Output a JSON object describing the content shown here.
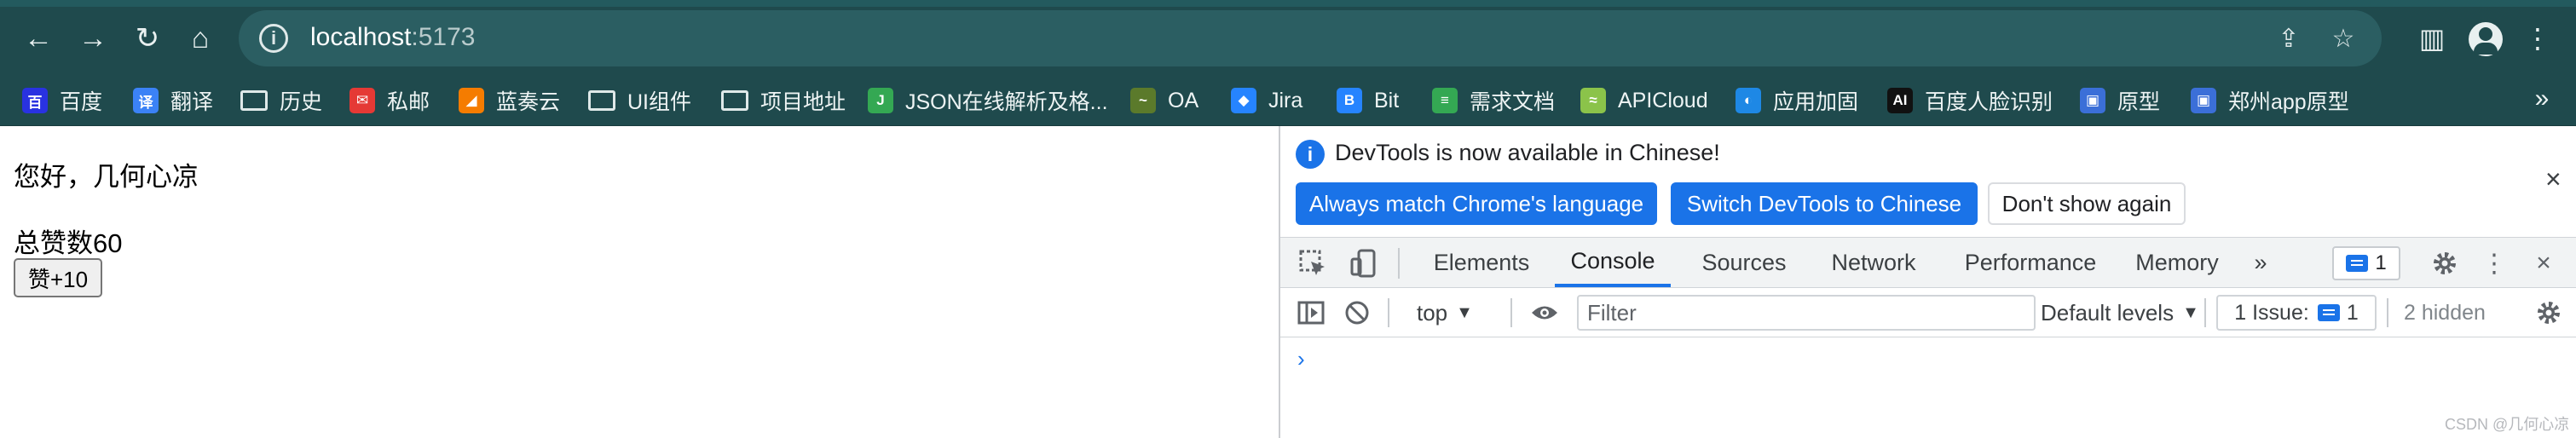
{
  "browser": {
    "url_host": "localhost",
    "url_port": ":5173",
    "nav": {
      "back": "←",
      "forward": "→",
      "reload": "↻",
      "home": "⌂"
    },
    "icons": {
      "info": "i",
      "share": "⇪",
      "star": "☆",
      "sidepanel": "▥",
      "menu": "⋮"
    }
  },
  "bookmarks": [
    {
      "label": "百度",
      "icon": "baidu-icon",
      "icon_text": "百",
      "color": "#2932e1"
    },
    {
      "label": "翻译",
      "icon": "translate-icon",
      "icon_text": "译",
      "color": "#3b82f6"
    },
    {
      "label": "历史",
      "icon": "folder-icon",
      "icon_text": "",
      "color": ""
    },
    {
      "label": "私邮",
      "icon": "mail-icon",
      "icon_text": "✉",
      "color": "#e53935"
    },
    {
      "label": "蓝奏云",
      "icon": "cloud-icon",
      "icon_text": "◢",
      "color": "#f57c00"
    },
    {
      "label": "UI组件",
      "icon": "folder-icon",
      "icon_text": "",
      "color": ""
    },
    {
      "label": "项目地址",
      "icon": "folder-icon",
      "icon_text": "",
      "color": ""
    },
    {
      "label": "JSON在线解析及格...",
      "icon": "json-icon",
      "icon_text": "J",
      "color": "#34a853"
    },
    {
      "label": "OA",
      "icon": "oa-icon",
      "icon_text": "~",
      "color": "#5b7a2b"
    },
    {
      "label": "Jira",
      "icon": "jira-icon",
      "icon_text": "◆",
      "color": "#2684ff"
    },
    {
      "label": "Bit",
      "icon": "bitbucket-icon",
      "icon_text": "B",
      "color": "#2684ff"
    },
    {
      "label": "需求文档",
      "icon": "sheet-icon",
      "icon_text": "≡",
      "color": "#34a853"
    },
    {
      "label": "APICloud",
      "icon": "apicloud-icon",
      "icon_text": "≈",
      "color": "#8bc34a"
    },
    {
      "label": "应用加固",
      "icon": "shield-icon",
      "icon_text": "◐",
      "color": "#1e88e5"
    },
    {
      "label": "百度人脸识别",
      "icon": "ai-icon",
      "icon_text": "AI",
      "color": "#111111"
    },
    {
      "label": "原型",
      "icon": "prototype-icon",
      "icon_text": "▣",
      "color": "#3b6fd8"
    },
    {
      "label": "郑州app原型",
      "icon": "prototype-icon",
      "icon_text": "▣",
      "color": "#3b6fd8"
    }
  ],
  "bookmarks_more": "»",
  "page": {
    "greeting": "您好，几何心凉",
    "likes_text": "总赞数60",
    "like_button": "赞+10"
  },
  "devtools": {
    "notice": {
      "message": "DevTools is now available in Chinese!",
      "btn_match": "Always match Chrome's language",
      "btn_switch": "Switch DevTools to Chinese",
      "btn_dismiss": "Don't show again",
      "close": "×"
    },
    "tabs": [
      "Elements",
      "Console",
      "Sources",
      "Network",
      "Performance",
      "Memory"
    ],
    "active_tab": "Console",
    "more_tabs": "»",
    "message_count": "1",
    "toolbar": {
      "context": "top",
      "filter_placeholder": "Filter",
      "levels": "Default levels",
      "issues_label": "1 Issue:",
      "issues_count": "1",
      "hidden": "2 hidden"
    },
    "prompt": "›"
  },
  "watermark": "CSDN @几何心凉",
  "colors": {
    "accent": "#1a73e8",
    "frame": "#1f4a4d"
  }
}
